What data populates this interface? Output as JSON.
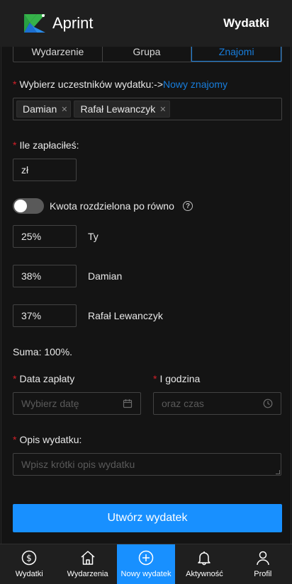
{
  "header": {
    "app_name": "Aprint",
    "page_title": "Wydatki"
  },
  "tabs": [
    {
      "label": "Wydarzenie",
      "active": false
    },
    {
      "label": "Grupa",
      "active": false
    },
    {
      "label": "Znajomi",
      "active": true
    }
  ],
  "participants": {
    "label": "Wybierz uczestników wydatku:->",
    "new_friends_link": "Nowy znajomy",
    "selected": [
      "Damian",
      "Rafał Lewanczyk"
    ]
  },
  "paid": {
    "label": "Ile zapłaciłeś:",
    "value": "zł"
  },
  "split": {
    "toggle_label": "Kwota rozdzielona po równo",
    "equal": false
  },
  "shares": [
    {
      "value": "25%",
      "name": "Ty"
    },
    {
      "value": "38%",
      "name": "Damian"
    },
    {
      "value": "37%",
      "name": "Rafał Lewanczyk"
    }
  ],
  "sum_text": "Suma: 100%.",
  "date": {
    "label": "Data zapłaty",
    "placeholder": "Wybierz datę"
  },
  "time": {
    "label": "I godzina",
    "placeholder": "oraz czas"
  },
  "description": {
    "label": "Opis wydatku:",
    "placeholder": "Wpisz krótki opis wydatku"
  },
  "submit_label": "Utwórz wydatek",
  "bottom_nav": [
    {
      "label": "Wydatki",
      "icon": "dollar-icon"
    },
    {
      "label": "Wydarzenia",
      "icon": "home-icon"
    },
    {
      "label": "Nowy wydatek",
      "icon": "plus-circle-icon",
      "active": true
    },
    {
      "label": "Aktywność",
      "icon": "bell-icon"
    },
    {
      "label": "Profil",
      "icon": "user-icon"
    }
  ],
  "colors": {
    "accent": "#1890ff",
    "link": "#177ddc",
    "required": "#d32029",
    "background": "#141414",
    "header": "#1f1f1f"
  }
}
